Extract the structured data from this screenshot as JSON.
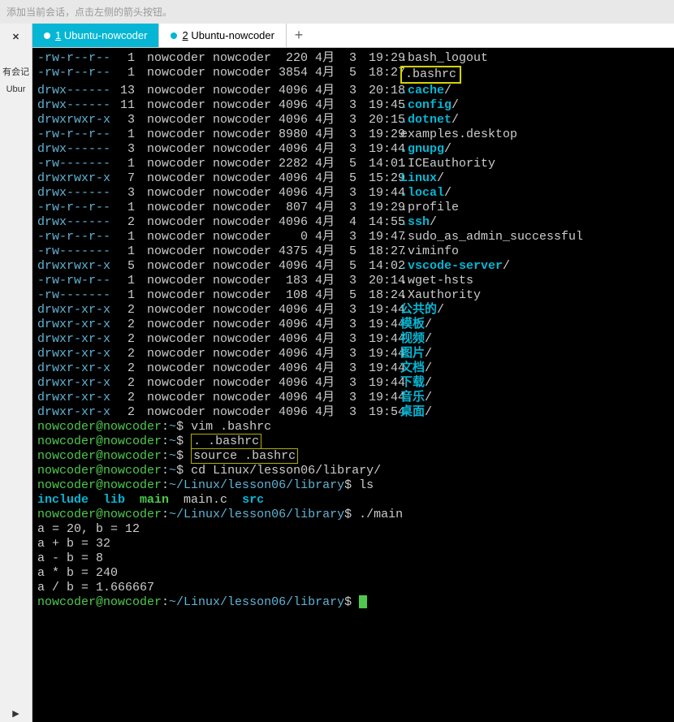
{
  "topmsg": "添加当前会话，点击左侧的箭头按钮。",
  "sidebar": {
    "close": "✕",
    "item1": "有会记",
    "item2": "Ubur"
  },
  "tabs": {
    "t1_num": "1",
    "t1_label": "Ubuntu-nowcoder",
    "t2_num": "2",
    "t2_label": "Ubuntu-nowcoder",
    "add": "+"
  },
  "ls": [
    {
      "p": "-rw-r--r--",
      "l": "1",
      "o": "nowcoder nowcoder",
      "s": "220",
      "m": "4月",
      "d": "3",
      "t": "19:29",
      "n": ".bash_logout",
      "dir": false,
      "hl": false
    },
    {
      "p": "-rw-r--r--",
      "l": "1",
      "o": "nowcoder nowcoder",
      "s": "3854",
      "m": "4月",
      "d": "5",
      "t": "18:27",
      "n": ".bashrc",
      "dir": false,
      "hl": true
    },
    {
      "p": "drwx------",
      "l": "13",
      "o": "nowcoder nowcoder",
      "s": "4096",
      "m": "4月",
      "d": "3",
      "t": "20:18",
      "n": ".cache",
      "dir": true,
      "hl": false
    },
    {
      "p": "drwx------",
      "l": "11",
      "o": "nowcoder nowcoder",
      "s": "4096",
      "m": "4月",
      "d": "3",
      "t": "19:45",
      "n": ".config",
      "dir": true,
      "hl": false
    },
    {
      "p": "drwxrwxr-x",
      "l": "3",
      "o": "nowcoder nowcoder",
      "s": "4096",
      "m": "4月",
      "d": "3",
      "t": "20:15",
      "n": ".dotnet",
      "dir": true,
      "hl": false
    },
    {
      "p": "-rw-r--r--",
      "l": "1",
      "o": "nowcoder nowcoder",
      "s": "8980",
      "m": "4月",
      "d": "3",
      "t": "19:29",
      "n": "examples.desktop",
      "dir": false,
      "hl": false
    },
    {
      "p": "drwx------",
      "l": "3",
      "o": "nowcoder nowcoder",
      "s": "4096",
      "m": "4月",
      "d": "3",
      "t": "19:44",
      "n": ".gnupg",
      "dir": true,
      "hl": false
    },
    {
      "p": "-rw-------",
      "l": "1",
      "o": "nowcoder nowcoder",
      "s": "2282",
      "m": "4月",
      "d": "5",
      "t": "14:01",
      "n": ".ICEauthority",
      "dir": false,
      "hl": false
    },
    {
      "p": "drwxrwxr-x",
      "l": "7",
      "o": "nowcoder nowcoder",
      "s": "4096",
      "m": "4月",
      "d": "5",
      "t": "15:29",
      "n": "Linux",
      "dir": true,
      "hl": false
    },
    {
      "p": "drwx------",
      "l": "3",
      "o": "nowcoder nowcoder",
      "s": "4096",
      "m": "4月",
      "d": "3",
      "t": "19:44",
      "n": ".local",
      "dir": true,
      "hl": false
    },
    {
      "p": "-rw-r--r--",
      "l": "1",
      "o": "nowcoder nowcoder",
      "s": "807",
      "m": "4月",
      "d": "3",
      "t": "19:29",
      "n": ".profile",
      "dir": false,
      "hl": false
    },
    {
      "p": "drwx------",
      "l": "2",
      "o": "nowcoder nowcoder",
      "s": "4096",
      "m": "4月",
      "d": "4",
      "t": "14:55",
      "n": ".ssh",
      "dir": true,
      "hl": false
    },
    {
      "p": "-rw-r--r--",
      "l": "1",
      "o": "nowcoder nowcoder",
      "s": "0",
      "m": "4月",
      "d": "3",
      "t": "19:47",
      "n": ".sudo_as_admin_successful",
      "dir": false,
      "hl": false
    },
    {
      "p": "-rw-------",
      "l": "1",
      "o": "nowcoder nowcoder",
      "s": "4375",
      "m": "4月",
      "d": "5",
      "t": "18:27",
      "n": ".viminfo",
      "dir": false,
      "hl": false
    },
    {
      "p": "drwxrwxr-x",
      "l": "5",
      "o": "nowcoder nowcoder",
      "s": "4096",
      "m": "4月",
      "d": "5",
      "t": "14:02",
      "n": ".vscode-server",
      "dir": true,
      "hl": false
    },
    {
      "p": "-rw-rw-r--",
      "l": "1",
      "o": "nowcoder nowcoder",
      "s": "183",
      "m": "4月",
      "d": "3",
      "t": "20:14",
      "n": ".wget-hsts",
      "dir": false,
      "hl": false
    },
    {
      "p": "-rw-------",
      "l": "1",
      "o": "nowcoder nowcoder",
      "s": "108",
      "m": "4月",
      "d": "5",
      "t": "18:24",
      "n": ".Xauthority",
      "dir": false,
      "hl": false
    },
    {
      "p": "drwxr-xr-x",
      "l": "2",
      "o": "nowcoder nowcoder",
      "s": "4096",
      "m": "4月",
      "d": "3",
      "t": "19:44",
      "n": "公共的",
      "dir": true,
      "hl": false
    },
    {
      "p": "drwxr-xr-x",
      "l": "2",
      "o": "nowcoder nowcoder",
      "s": "4096",
      "m": "4月",
      "d": "3",
      "t": "19:44",
      "n": "模板",
      "dir": true,
      "hl": false
    },
    {
      "p": "drwxr-xr-x",
      "l": "2",
      "o": "nowcoder nowcoder",
      "s": "4096",
      "m": "4月",
      "d": "3",
      "t": "19:44",
      "n": "视频",
      "dir": true,
      "hl": false
    },
    {
      "p": "drwxr-xr-x",
      "l": "2",
      "o": "nowcoder nowcoder",
      "s": "4096",
      "m": "4月",
      "d": "3",
      "t": "19:44",
      "n": "图片",
      "dir": true,
      "hl": false
    },
    {
      "p": "drwxr-xr-x",
      "l": "2",
      "o": "nowcoder nowcoder",
      "s": "4096",
      "m": "4月",
      "d": "3",
      "t": "19:44",
      "n": "文档",
      "dir": true,
      "hl": false
    },
    {
      "p": "drwxr-xr-x",
      "l": "2",
      "o": "nowcoder nowcoder",
      "s": "4096",
      "m": "4月",
      "d": "3",
      "t": "19:44",
      "n": "下载",
      "dir": true,
      "hl": false
    },
    {
      "p": "drwxr-xr-x",
      "l": "2",
      "o": "nowcoder nowcoder",
      "s": "4096",
      "m": "4月",
      "d": "3",
      "t": "19:44",
      "n": "音乐",
      "dir": true,
      "hl": false
    },
    {
      "p": "drwxr-xr-x",
      "l": "2",
      "o": "nowcoder nowcoder",
      "s": "4096",
      "m": "4月",
      "d": "3",
      "t": "19:54",
      "n": "桌面",
      "dir": true,
      "hl": false
    }
  ],
  "prompts": {
    "user": "nowcoder@nowcoder",
    "colon": ":",
    "home": "~",
    "dollar": "$",
    "path2": "~/Linux/lesson06/library"
  },
  "cmds": {
    "c1": "vim .bashrc",
    "c2": ". .bashrc",
    "c3": "source .bashrc",
    "c4": "cd Linux/lesson06/library/",
    "c5": "ls",
    "c6": "./main"
  },
  "lsout": {
    "i1": "include",
    "i2": "lib",
    "i3": "main",
    "i4": "main.c",
    "i5": "src"
  },
  "out": {
    "l1": "a = 20, b = 12",
    "l2": "a + b = 32",
    "l3": "a - b = 8",
    "l4": "a * b = 240",
    "l5": "a / b = 1.666667"
  }
}
